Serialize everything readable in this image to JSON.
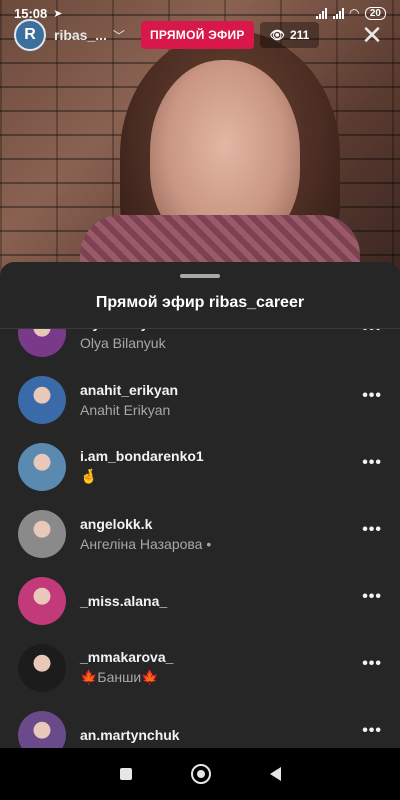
{
  "status_bar": {
    "time": "15:08",
    "battery": "20"
  },
  "live_header": {
    "host_username": "ribas_...",
    "live_badge": "ПРЯМОЙ ЭФИР",
    "viewer_count": "211"
  },
  "sheet": {
    "title": "Прямой эфир ribas_career",
    "viewers": [
      {
        "username": "olyabilanyuk",
        "full_name": "Olya Bilanyuk",
        "avatar_color": "#7a3a8a"
      },
      {
        "username": "anahit_erikyan",
        "full_name": "Anahit Erikyan",
        "avatar_color": "#3a6aa8"
      },
      {
        "username": "i.am_bondarenko1",
        "full_name": "🤞",
        "avatar_color": "#5a8ab0"
      },
      {
        "username": "angelokk.k",
        "full_name": "Ангеліна Назарова •",
        "avatar_color": "#8a8a8a"
      },
      {
        "username": "_miss.alana_",
        "full_name": "",
        "avatar_color": "#c23a7a"
      },
      {
        "username": "_mmakarova_",
        "full_name": "🍁Банши🍁",
        "avatar_color": "#1c1c1c"
      },
      {
        "username": "an.martynchuk",
        "full_name": "",
        "avatar_color": "#6a4a8a"
      }
    ]
  },
  "nav": {
    "icons": [
      "recent-apps-icon",
      "home-icon",
      "back-icon"
    ]
  }
}
